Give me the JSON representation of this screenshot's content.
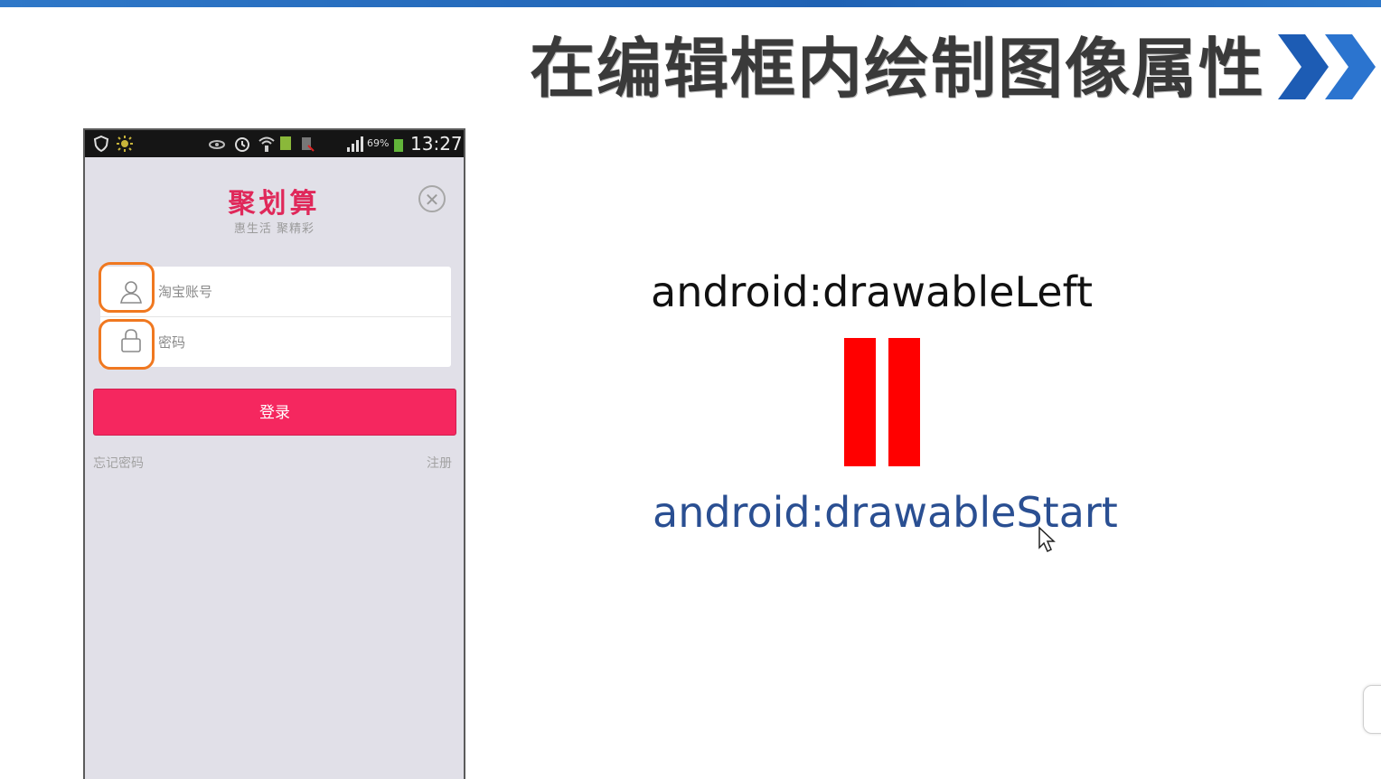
{
  "slide": {
    "title": "在编辑框内绘制图像属性",
    "attr_left": "android:drawableLeft",
    "attr_start": "android:drawableStart",
    "accent_color": "#ff0000",
    "start_text_color": "#2a4f92"
  },
  "phone": {
    "status_bar": {
      "battery_percent": "69%",
      "time": "13:27",
      "icons": [
        "shield-icon",
        "brightness-icon",
        "eye-icon",
        "alarm-icon",
        "wifi-icon",
        "sim-icon",
        "battery-saver-icon",
        "signal-icon",
        "battery-icon"
      ]
    },
    "app": {
      "logo": "聚划算",
      "slogan": "惠生活 聚精彩",
      "brand_color": "#f5275f"
    },
    "form": {
      "account_placeholder": "淘宝账号",
      "password_placeholder": "密码",
      "login_label": "登录",
      "forgot_label": "忘记密码",
      "register_label": "注册"
    }
  }
}
